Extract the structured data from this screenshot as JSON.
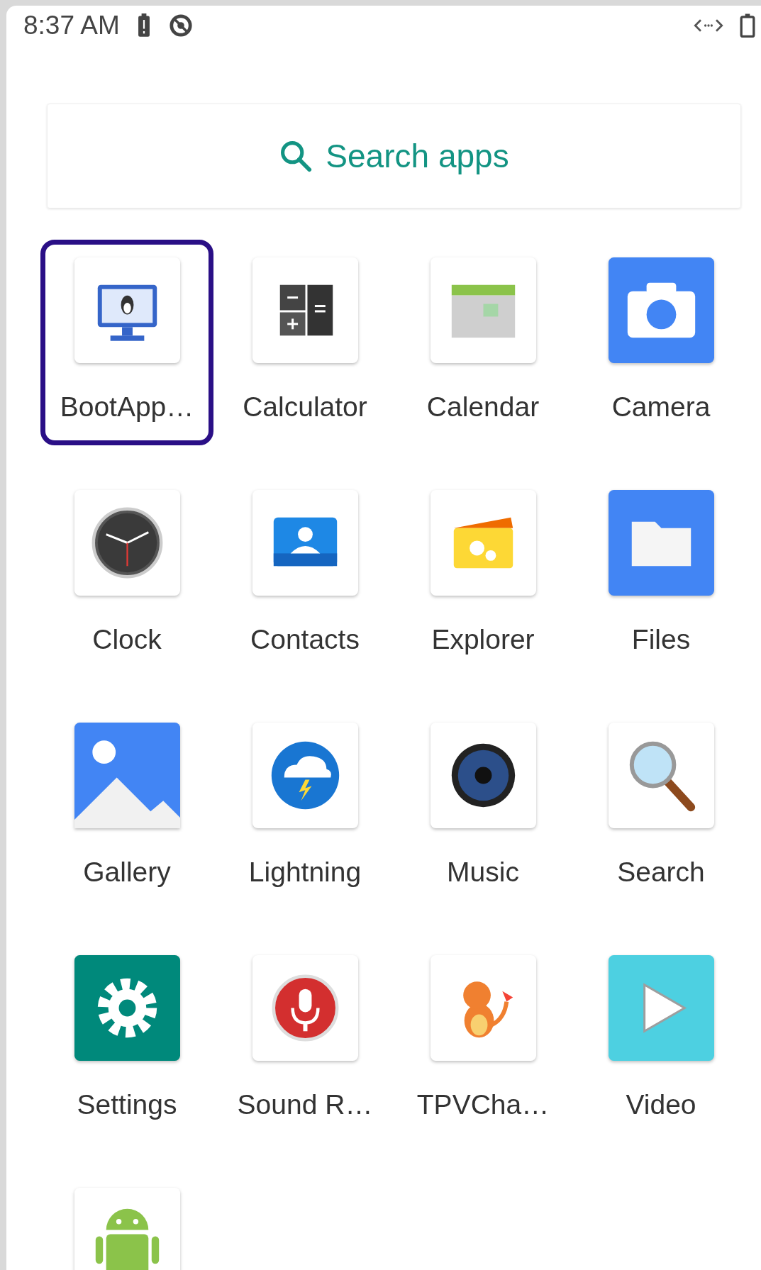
{
  "status_bar": {
    "time": "8:37 AM"
  },
  "search": {
    "placeholder": "Search apps"
  },
  "apps": [
    {
      "label": "BootApp…",
      "kind": "monitor",
      "selected": true
    },
    {
      "label": "Calculator",
      "kind": "calculator",
      "selected": false
    },
    {
      "label": "Calendar",
      "kind": "calendar",
      "selected": false
    },
    {
      "label": "Camera",
      "kind": "camera",
      "selected": false
    },
    {
      "label": "Clock",
      "kind": "clock",
      "selected": false
    },
    {
      "label": "Contacts",
      "kind": "contacts",
      "selected": false
    },
    {
      "label": "Explorer",
      "kind": "explorer",
      "selected": false
    },
    {
      "label": "Files",
      "kind": "files",
      "selected": false
    },
    {
      "label": "Gallery",
      "kind": "gallery",
      "selected": false
    },
    {
      "label": "Lightning",
      "kind": "lightning",
      "selected": false
    },
    {
      "label": "Music",
      "kind": "music",
      "selected": false
    },
    {
      "label": "Search",
      "kind": "magnifier",
      "selected": false
    },
    {
      "label": "Settings",
      "kind": "settings",
      "selected": false
    },
    {
      "label": "Sound R…",
      "kind": "recorder",
      "selected": false
    },
    {
      "label": "TPVCha…",
      "kind": "creature",
      "selected": false
    },
    {
      "label": "Video",
      "kind": "video",
      "selected": false
    },
    {
      "kind": "android",
      "selected": false
    }
  ]
}
